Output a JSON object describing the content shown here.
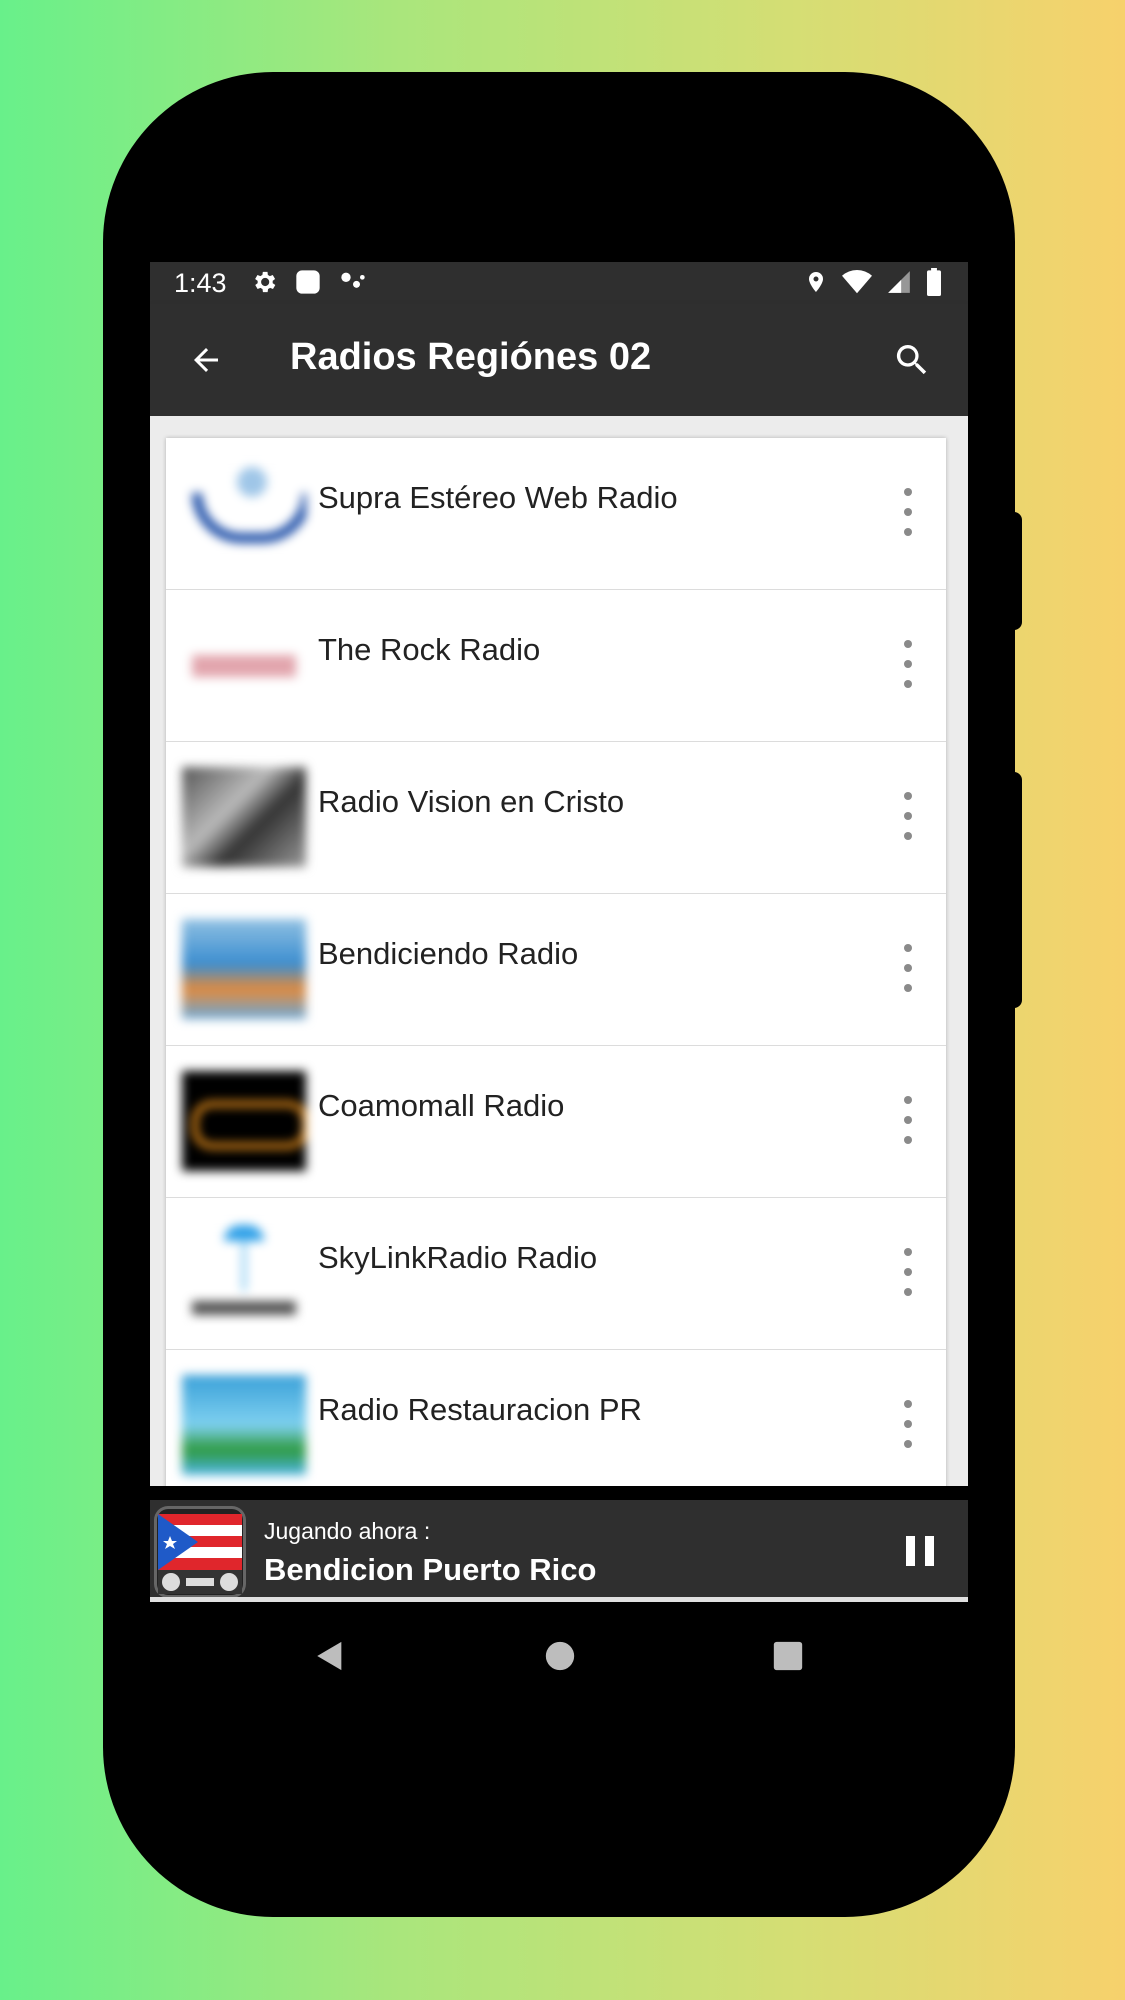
{
  "status_bar": {
    "time": "1:43"
  },
  "app_bar": {
    "title": "Radios Regiónes 02"
  },
  "stations": [
    {
      "name": "Supra Estéreo Web Radio"
    },
    {
      "name": "The Rock Radio"
    },
    {
      "name": "Radio Vision en Cristo"
    },
    {
      "name": "Bendiciendo Radio"
    },
    {
      "name": "Coamomall Radio"
    },
    {
      "name": "SkyLinkRadio Radio"
    },
    {
      "name": "Radio Restauracion PR"
    }
  ],
  "player": {
    "label": "Jugando ahora :",
    "station": "Bendicion Puerto Rico"
  },
  "colors": {
    "bar_background": "#2f2f2f",
    "list_background": "#ececec"
  },
  "icons": {
    "back": "arrow-left-icon",
    "search": "search-icon",
    "more": "more-vertical-icon",
    "pause": "pause-icon"
  }
}
